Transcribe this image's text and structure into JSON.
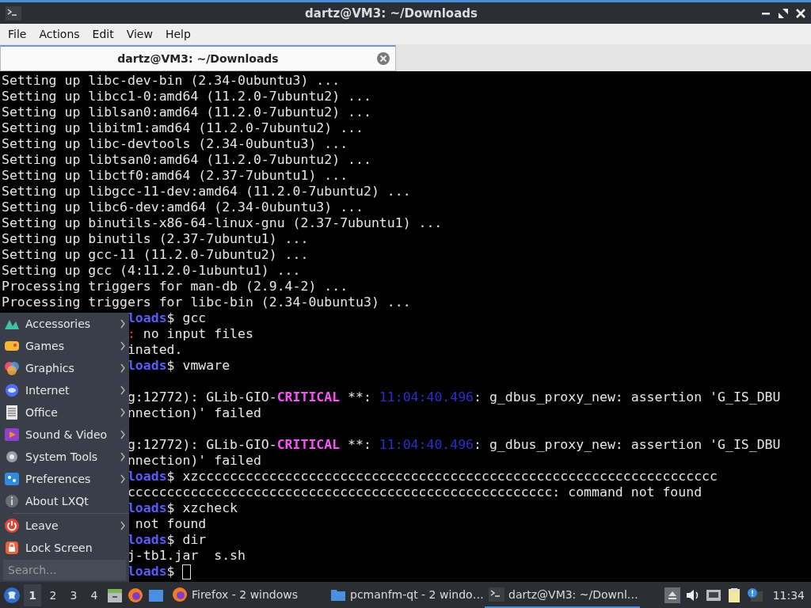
{
  "window": {
    "title": "dartz@VM3: ~/Downloads"
  },
  "menubar": [
    "File",
    "Actions",
    "Edit",
    "View",
    "Help"
  ],
  "tabs": [
    {
      "label": "dartz@VM3: ~/Downloads",
      "selected": true
    }
  ],
  "terminal": {
    "lines": [
      {
        "kind": "full",
        "segments": [
          {
            "kind": "plain",
            "text": "Setting up libc-dev-bin (2.34-0ubuntu3) ..."
          }
        ]
      },
      {
        "kind": "full",
        "segments": [
          {
            "kind": "plain",
            "text": "Setting up libcc1-0:amd64 (11.2.0-7ubuntu2) ..."
          }
        ]
      },
      {
        "kind": "full",
        "segments": [
          {
            "kind": "plain",
            "text": "Setting up liblsan0:amd64 (11.2.0-7ubuntu2) ..."
          }
        ]
      },
      {
        "kind": "full",
        "segments": [
          {
            "kind": "plain",
            "text": "Setting up libitm1:amd64 (11.2.0-7ubuntu2) ..."
          }
        ]
      },
      {
        "kind": "full",
        "segments": [
          {
            "kind": "plain",
            "text": "Setting up libc-devtools (2.34-0ubuntu3) ..."
          }
        ]
      },
      {
        "kind": "full",
        "segments": [
          {
            "kind": "plain",
            "text": "Setting up libtsan0:amd64 (11.2.0-7ubuntu2) ..."
          }
        ]
      },
      {
        "kind": "full",
        "segments": [
          {
            "kind": "plain",
            "text": "Setting up libctf0:amd64 (2.37-7ubuntu1) ..."
          }
        ]
      },
      {
        "kind": "full",
        "segments": [
          {
            "kind": "plain",
            "text": "Setting up libgcc-11-dev:amd64 (11.2.0-7ubuntu2) ..."
          }
        ]
      },
      {
        "kind": "full",
        "segments": [
          {
            "kind": "plain",
            "text": "Setting up libc6-dev:amd64 (2.34-0ubuntu3) ..."
          }
        ]
      },
      {
        "kind": "full",
        "segments": [
          {
            "kind": "plain",
            "text": "Setting up binutils-x86-64-linux-gnu (2.37-7ubuntu1) ..."
          }
        ]
      },
      {
        "kind": "full",
        "segments": [
          {
            "kind": "plain",
            "text": "Setting up binutils (2.37-7ubuntu1) ..."
          }
        ]
      },
      {
        "kind": "full",
        "segments": [
          {
            "kind": "plain",
            "text": "Setting up gcc-11 (11.2.0-7ubuntu2) ..."
          }
        ]
      },
      {
        "kind": "full",
        "segments": [
          {
            "kind": "plain",
            "text": "Setting up gcc (4:11.2.0-1ubuntu1) ..."
          }
        ]
      },
      {
        "kind": "full",
        "segments": [
          {
            "kind": "plain",
            "text": "Processing triggers for man-db (2.9.4-2) ..."
          }
        ]
      },
      {
        "kind": "full",
        "segments": [
          {
            "kind": "plain",
            "text": "Processing triggers for libc-bin (2.34-0ubuntu3) ..."
          }
        ]
      },
      {
        "kind": "partial",
        "segments": [
          {
            "kind": "prompt",
            "text": "loads"
          },
          {
            "kind": "plain",
            "text": "$ gcc"
          }
        ]
      },
      {
        "kind": "partial",
        "segments": [
          {
            "kind": "error",
            "text": ":"
          },
          {
            "kind": "plain",
            "text": " no input files"
          }
        ]
      },
      {
        "kind": "partial",
        "segments": [
          {
            "kind": "plain",
            "text": "inated."
          }
        ]
      },
      {
        "kind": "partial",
        "segments": [
          {
            "kind": "prompt",
            "text": "loads"
          },
          {
            "kind": "plain",
            "text": "$ vmware"
          }
        ]
      },
      {
        "kind": "partial"
      },
      {
        "kind": "partial",
        "segments": [
          {
            "kind": "plain",
            "text": "g:12772): GLib-GIO-"
          },
          {
            "kind": "critical",
            "text": "CRITICAL"
          },
          {
            "kind": "plain",
            "text": " **: "
          },
          {
            "kind": "time",
            "text": "11:04:40.496"
          },
          {
            "kind": "plain",
            "text": ": g_dbus_proxy_new: assertion 'G_IS_DBU"
          }
        ]
      },
      {
        "kind": "partial",
        "segments": [
          {
            "kind": "plain",
            "text": "nnection)' failed"
          }
        ]
      },
      {
        "kind": "partial"
      },
      {
        "kind": "partial",
        "segments": [
          {
            "kind": "plain",
            "text": "g:12772): GLib-GIO-"
          },
          {
            "kind": "critical",
            "text": "CRITICAL"
          },
          {
            "kind": "plain",
            "text": " **: "
          },
          {
            "kind": "time",
            "text": "11:04:40.496"
          },
          {
            "kind": "plain",
            "text": ": g_dbus_proxy_new: assertion 'G_IS_DBU"
          }
        ]
      },
      {
        "kind": "partial",
        "segments": [
          {
            "kind": "plain",
            "text": "nnection)' failed"
          }
        ]
      },
      {
        "kind": "partial",
        "segments": [
          {
            "kind": "prompt",
            "text": "loads"
          },
          {
            "kind": "plain",
            "text": "$ xzcccccccccccccccccccccccccccccccccccccccccccccccccccccccccccccccccc"
          }
        ]
      },
      {
        "kind": "partial",
        "segments": [
          {
            "kind": "plain",
            "text": "cccccccccccccccccccccccccccccccccccccccccccccccccccccc: command not found"
          }
        ]
      },
      {
        "kind": "partial",
        "segments": [
          {
            "kind": "prompt",
            "text": "loads"
          },
          {
            "kind": "plain",
            "text": "$ xzcheck"
          }
        ]
      },
      {
        "kind": "partial",
        "segments": [
          {
            "kind": "plain",
            "text": " not found"
          }
        ]
      },
      {
        "kind": "partial",
        "segments": [
          {
            "kind": "prompt",
            "text": "loads"
          },
          {
            "kind": "plain",
            "text": "$ dir"
          }
        ]
      },
      {
        "kind": "partial",
        "segments": [
          {
            "kind": "plain",
            "text": "j-tb1.jar  s.sh"
          }
        ]
      },
      {
        "kind": "partial",
        "cursor": true,
        "segments": [
          {
            "kind": "prompt",
            "text": "loads"
          },
          {
            "kind": "plain",
            "text": "$ "
          }
        ]
      }
    ]
  },
  "app_menu": {
    "sections": [
      [
        {
          "label": "Accessories",
          "submenu": true
        },
        {
          "label": "Games",
          "submenu": true
        },
        {
          "label": "Graphics",
          "submenu": true
        },
        {
          "label": "Internet",
          "submenu": true
        },
        {
          "label": "Office",
          "submenu": true
        },
        {
          "label": "Sound & Video",
          "submenu": true
        },
        {
          "label": "System Tools",
          "submenu": true
        },
        {
          "label": "Preferences",
          "submenu": true
        },
        {
          "label": "About LXQt",
          "submenu": false
        }
      ],
      [
        {
          "label": "Leave",
          "submenu": true
        },
        {
          "label": "Lock Screen",
          "submenu": false
        }
      ]
    ],
    "search": {
      "placeholder": "Search..."
    }
  },
  "taskbar": {
    "desktops": [
      {
        "label": "1",
        "selected": true
      },
      {
        "label": "2",
        "selected": false
      },
      {
        "label": "3",
        "selected": false
      },
      {
        "label": "4",
        "selected": false
      }
    ],
    "tasks": [
      {
        "label": "Firefox - 2 windows",
        "selected": false
      },
      {
        "label": "pcmanfm-qt - 2 windo…",
        "selected": false
      },
      {
        "label": "dartz@VM3: ~/Downl…",
        "selected": true
      }
    ],
    "clock": "11:34"
  }
}
